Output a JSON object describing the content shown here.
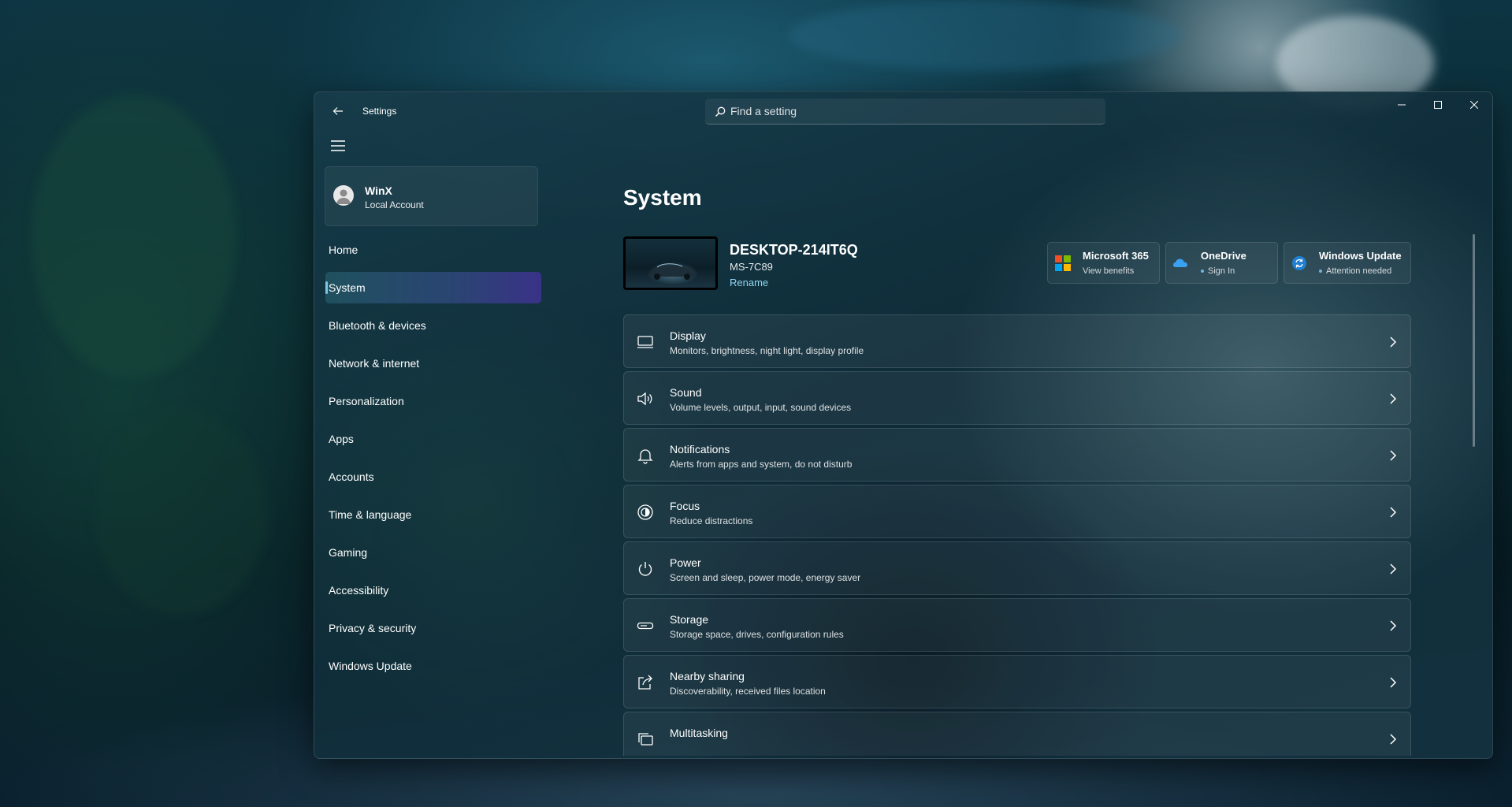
{
  "window": {
    "app_title": "Settings",
    "search_placeholder": "Find a setting"
  },
  "account": {
    "name": "WinX",
    "type": "Local Account"
  },
  "nav": {
    "items": [
      {
        "label": "Home"
      },
      {
        "label": "System",
        "active": true
      },
      {
        "label": "Bluetooth & devices"
      },
      {
        "label": "Network & internet"
      },
      {
        "label": "Personalization"
      },
      {
        "label": "Apps"
      },
      {
        "label": "Accounts"
      },
      {
        "label": "Time & language"
      },
      {
        "label": "Gaming"
      },
      {
        "label": "Accessibility"
      },
      {
        "label": "Privacy & security"
      },
      {
        "label": "Windows Update"
      }
    ]
  },
  "main": {
    "title": "System",
    "device": {
      "name": "DESKTOP-214IT6Q",
      "model": "MS-7C89",
      "rename_label": "Rename"
    },
    "tiles": [
      {
        "title": "Microsoft 365",
        "subtitle": "View benefits",
        "icon": "microsoft-logo-icon"
      },
      {
        "title": "OneDrive",
        "subtitle": "Sign In",
        "icon": "onedrive-cloud-icon"
      },
      {
        "title": "Windows Update",
        "subtitle": "Attention needed",
        "icon": "sync-icon"
      }
    ],
    "cards": [
      {
        "title": "Display",
        "subtitle": "Monitors, brightness, night light, display profile",
        "icon": "display-icon"
      },
      {
        "title": "Sound",
        "subtitle": "Volume levels, output, input, sound devices",
        "icon": "speaker-icon"
      },
      {
        "title": "Notifications",
        "subtitle": "Alerts from apps and system, do not disturb",
        "icon": "bell-icon"
      },
      {
        "title": "Focus",
        "subtitle": "Reduce distractions",
        "icon": "focus-icon"
      },
      {
        "title": "Power",
        "subtitle": "Screen and sleep, power mode, energy saver",
        "icon": "power-icon"
      },
      {
        "title": "Storage",
        "subtitle": "Storage space, drives, configuration rules",
        "icon": "storage-icon"
      },
      {
        "title": "Nearby sharing",
        "subtitle": "Discoverability, received files location",
        "icon": "share-icon"
      },
      {
        "title": "Multitasking",
        "subtitle": "",
        "icon": "multitasking-icon"
      }
    ]
  },
  "colors": {
    "accent_link": "#8fd6f2",
    "active_nav_gradient_end": "#3c328c"
  }
}
